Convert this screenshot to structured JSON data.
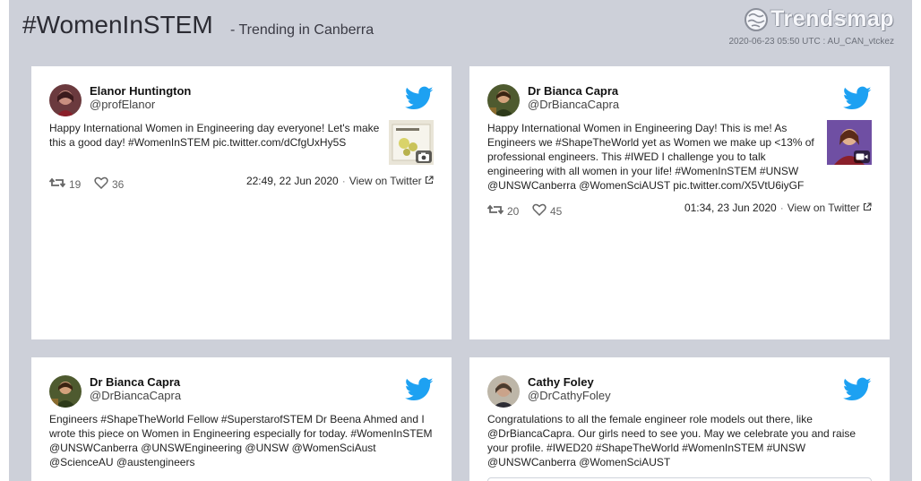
{
  "header": {
    "hashtag": "#WomenInSTEM",
    "subtitle": "- Trending in Canberra",
    "logo_text": "Trendsmap",
    "timestamp": "2020-06-23 05:50 UTC : AU_CAN_vtckez"
  },
  "colors": {
    "page_background": "#cdd0d9",
    "twitter_blue": "#1da1f2",
    "card_background": "#ffffff"
  },
  "tweets": [
    {
      "name": "Elanor Huntington",
      "handle": "@profElanor",
      "text": "Happy International Women in Engineering day everyone! Let's make this a good day! #WomenInSTEM pic.twitter.com/dCfgUxHy5S",
      "media_icon": "camera-icon",
      "retweets": "19",
      "likes": "36",
      "time": "22:49, 22 Jun 2020",
      "view_label": "View on Twitter"
    },
    {
      "name": "Dr Bianca Capra",
      "handle": "@DrBiancaCapra",
      "text": "Happy International Women in Engineering Day! This is me! As Engineers we #ShapeTheWorld yet as Women we make up <13% of professional engineers. This #IWED I challenge you to talk engineering with all women in your life! #WomenInSTEM #UNSW @UNSWCanberra @WomenSciAUST pic.twitter.com/X5VtU6iyGF",
      "media_icon": "video-icon",
      "retweets": "20",
      "likes": "45",
      "time": "01:34, 23 Jun 2020",
      "view_label": "View on Twitter"
    },
    {
      "name": "Dr Bianca Capra",
      "handle": "@DrBiancaCapra",
      "text": "Engineers #ShapeTheWorld Fellow #SuperstarofSTEM Dr Beena Ahmed and I wrote this piece on Women in Engineering especially for today. #WomenInSTEM @UNSWCanberra @UNSWEngineering @UNSW @WomenSciAust @ScienceAU @austengineers"
    },
    {
      "name": "Cathy Foley",
      "handle": "@DrCathyFoley",
      "text": "Congratulations to all the female engineer role models out there, like @DrBiancaCapra. Our girls need to see you. May we celebrate you and raise your profile. #IWED20 #ShapeTheWorld #WomenInSTEM #UNSW @UNSWCanberra @WomenSciAUST"
    }
  ]
}
